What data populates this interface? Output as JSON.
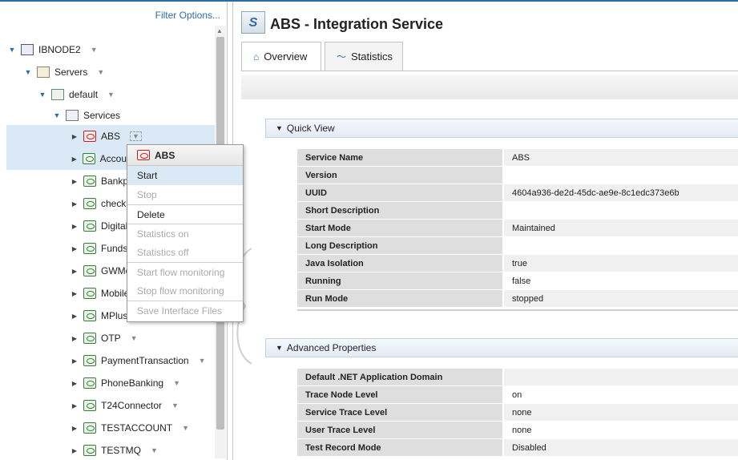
{
  "left_panel": {
    "filter_link": "Filter Options...",
    "tree": {
      "node": "IBNODE2",
      "servers": "Servers",
      "default": "default",
      "services": "Services",
      "items": [
        {
          "label": "ABS",
          "selected": true
        },
        {
          "label": "Accou"
        },
        {
          "label": "Bankp"
        },
        {
          "label": "checkr"
        },
        {
          "label": "Digital"
        },
        {
          "label": "Funds"
        },
        {
          "label": "GWMo"
        },
        {
          "label": "Mobile"
        },
        {
          "label": "MPlus"
        },
        {
          "label": "OTP"
        },
        {
          "label": "PaymentTransaction"
        },
        {
          "label": "PhoneBanking"
        },
        {
          "label": "T24Connector"
        },
        {
          "label": "TESTACCOUNT"
        },
        {
          "label": "TESTMQ"
        }
      ]
    }
  },
  "context_menu": {
    "header": "ABS",
    "items": [
      {
        "label": "Start",
        "enabled": true,
        "selected": true
      },
      {
        "label": "Stop",
        "enabled": false
      },
      {
        "label": "Delete",
        "enabled": true
      },
      {
        "label": "Statistics on",
        "enabled": false
      },
      {
        "label": "Statistics off",
        "enabled": false
      },
      {
        "label": "Start flow monitoring",
        "enabled": false
      },
      {
        "label": "Stop flow monitoring",
        "enabled": false
      },
      {
        "label": "Save Interface Files",
        "enabled": false
      }
    ]
  },
  "right_panel": {
    "title_icon_letter": "S",
    "title": "ABS - Integration Service",
    "tabs": [
      {
        "label": "Overview",
        "active": true
      },
      {
        "label": "Statistics",
        "active": false
      }
    ],
    "quick_view": {
      "heading": "Quick View",
      "rows": [
        {
          "key": "Service Name",
          "value": "ABS"
        },
        {
          "key": "Version",
          "value": ""
        },
        {
          "key": "UUID",
          "value": "4604a936-de2d-45dc-ae9e-8c1edc373e6b"
        },
        {
          "key": "Short Description",
          "value": ""
        },
        {
          "key": "Start Mode",
          "value": "Maintained"
        },
        {
          "key": "Long Description",
          "value": ""
        },
        {
          "key": "Java Isolation",
          "value": "true"
        },
        {
          "key": "Running",
          "value": "false"
        },
        {
          "key": "Run Mode",
          "value": "stopped"
        }
      ]
    },
    "advanced": {
      "heading": "Advanced Properties",
      "rows": [
        {
          "key": "Default .NET Application Domain",
          "value": ""
        },
        {
          "key": "Trace Node Level",
          "value": "on"
        },
        {
          "key": "Service Trace Level",
          "value": "none"
        },
        {
          "key": "User Trace Level",
          "value": "none"
        },
        {
          "key": "Test Record Mode",
          "value": "Disabled"
        }
      ]
    }
  }
}
